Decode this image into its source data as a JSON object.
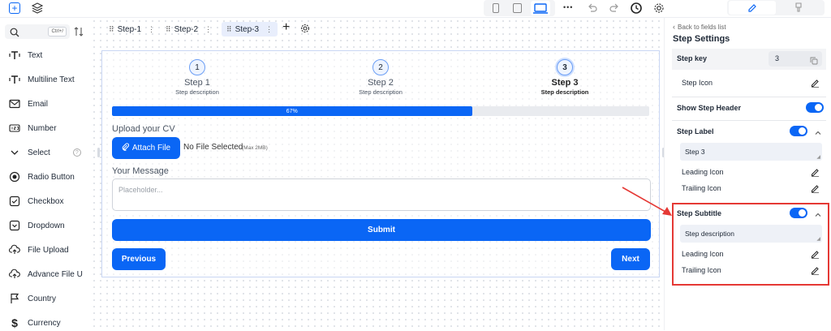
{
  "topbar": {
    "device_icons": [
      "mobile-icon",
      "tablet-icon",
      "desktop-icon"
    ],
    "more_label": "•••"
  },
  "sidebar": {
    "search_placeholder": "",
    "search_shortcut": "Ctrl+/",
    "items": [
      {
        "label": "Text",
        "icon": "text-icon"
      },
      {
        "label": "Multiline Text",
        "icon": "multiline-text-icon"
      },
      {
        "label": "Email",
        "icon": "email-icon"
      },
      {
        "label": "Number",
        "icon": "number-icon"
      },
      {
        "label": "Select",
        "icon": "chevron-down-icon"
      },
      {
        "label": "Radio Button",
        "icon": "radio-icon"
      },
      {
        "label": "Checkbox",
        "icon": "checkbox-icon"
      },
      {
        "label": "Dropdown",
        "icon": "dropdown-icon"
      },
      {
        "label": "File Upload",
        "icon": "upload-icon"
      },
      {
        "label": "Advance File U",
        "icon": "upload-icon"
      },
      {
        "label": "Country",
        "icon": "flag-icon"
      },
      {
        "label": "Currency",
        "icon": "dollar-icon"
      }
    ]
  },
  "tabs": [
    {
      "label": "Step-1"
    },
    {
      "label": "Step-2"
    },
    {
      "label": "Step-3"
    }
  ],
  "form": {
    "steps": [
      {
        "num": "1",
        "label": "Step 1",
        "desc": "Step description"
      },
      {
        "num": "2",
        "label": "Step 2",
        "desc": "Step description"
      },
      {
        "num": "3",
        "label": "Step 3",
        "desc": "Step description"
      }
    ],
    "progress_fraction": 0.67,
    "progress_label": "67%",
    "cv_label": "Upload your CV",
    "attach_label": "Attach File",
    "no_file": "No File Selected",
    "max_size": "(Max 2MB)",
    "message_label": "Your Message",
    "message_placeholder": "Placeholder...",
    "submit_label": "Submit",
    "previous_label": "Previous",
    "next_label": "Next"
  },
  "panel": {
    "back_label": "Back to fields list",
    "title": "Step Settings",
    "step_key_label": "Step key",
    "step_key_value": "3",
    "step_icon_label": "Step Icon",
    "show_header_label": "Show Step Header",
    "step_label_label": "Step Label",
    "step_label_value": "Step 3",
    "leading_icon": "Leading Icon",
    "trailing_icon": "Trailing Icon",
    "step_subtitle_label": "Step Subtitle",
    "step_subtitle_value": "Step description",
    "leading_icon_2": "Leading Icon",
    "trailing_icon_2": "Trailing Icon"
  },
  "colors": {
    "accent": "#0a66f5",
    "highlight_box": "#e53935",
    "arrow": "#e53935"
  }
}
